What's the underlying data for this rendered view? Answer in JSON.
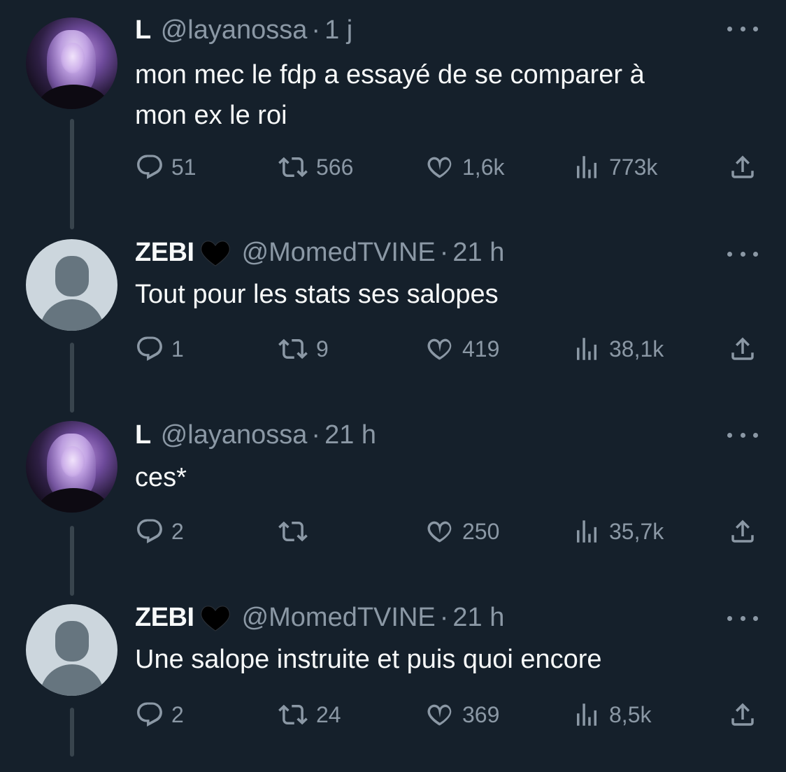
{
  "tweets": [
    {
      "avatar": "user-photo",
      "name": "L",
      "has_heart": false,
      "handle": "@layanossa",
      "separator": "·",
      "time": "1 j",
      "lines": [
        "mon mec le fdp a essayé de se comparer à",
        "mon ex le roi"
      ],
      "replies": "51",
      "retweets": "566",
      "likes": "1,6k",
      "views": "773k"
    },
    {
      "avatar": "default-avatar",
      "name": "ZEBI",
      "has_heart": true,
      "handle": "@MomedTVINE",
      "separator": "·",
      "time": "21 h",
      "lines": [
        "Tout pour les stats ses salopes"
      ],
      "replies": "1",
      "retweets": "9",
      "likes": "419",
      "views": "38,1k"
    },
    {
      "avatar": "user-photo",
      "name": "L",
      "has_heart": false,
      "handle": "@layanossa",
      "separator": "·",
      "time": "21 h",
      "lines": [
        "ces*"
      ],
      "replies": "2",
      "retweets": "",
      "likes": "250",
      "views": "35,7k"
    },
    {
      "avatar": "default-avatar",
      "name": "ZEBI",
      "has_heart": true,
      "handle": "@MomedTVINE",
      "separator": "·",
      "time": "21 h",
      "lines": [
        "Une salope instruite et puis quoi encore"
      ],
      "replies": "2",
      "retweets": "24",
      "likes": "369",
      "views": "8,5k"
    }
  ],
  "colors": {
    "background": "#15202b",
    "text_primary": "#f7f9f9",
    "text_secondary": "#8b98a5",
    "thread_line": "#38444d",
    "default_avatar_bg": "#ccd6dd",
    "heart_badge": "#000000"
  },
  "icons": {
    "reply": "reply-icon",
    "retweet": "retweet-icon",
    "like": "heart-icon",
    "views": "views-icon",
    "share": "share-icon",
    "more": "more-icon"
  }
}
